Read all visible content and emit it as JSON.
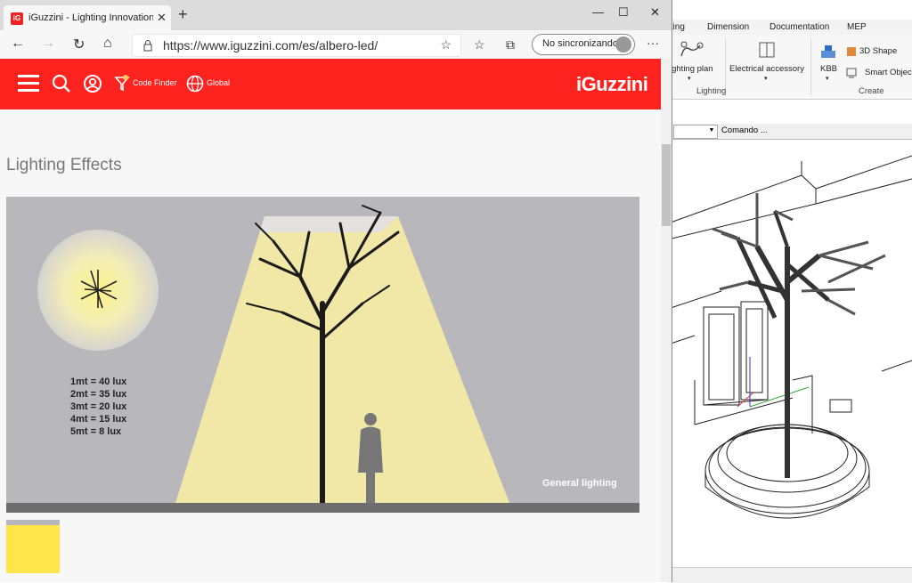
{
  "browser": {
    "tab_title": "iGuzzini - Lighting Innovation Fo",
    "favicon_text": "iG",
    "url": "https://www.iguzzini.com/es/albero-led/",
    "sync_label": "No sincronizando",
    "window_controls": [
      "minimize-icon",
      "maximize-icon",
      "close-icon"
    ]
  },
  "site": {
    "header_color": "#ff2320",
    "code_finder": "Code Finder",
    "global": "Global",
    "logo": "iGuzzini",
    "section_title": "Lighting Effects",
    "lux_lines": [
      "1mt = 40 lux",
      "2mt = 35 lux",
      "3mt = 20 lux",
      "4mt = 15 lux",
      "5mt = 8 lux"
    ],
    "effect_label": "General lighting"
  },
  "cad": {
    "tabs": [
      "fting",
      "Dimension",
      "Documentation",
      "MEP"
    ],
    "ribbon": {
      "lighting_plan": "ighting plan",
      "electrical_accessory": "Electrical accessory",
      "kbb": "KBB",
      "shape_3d": "3D Shape",
      "smart_objects": "Smart Objec",
      "group_lighting": "Lighting",
      "group_create": "Create"
    },
    "command_label": "Comando ..."
  }
}
